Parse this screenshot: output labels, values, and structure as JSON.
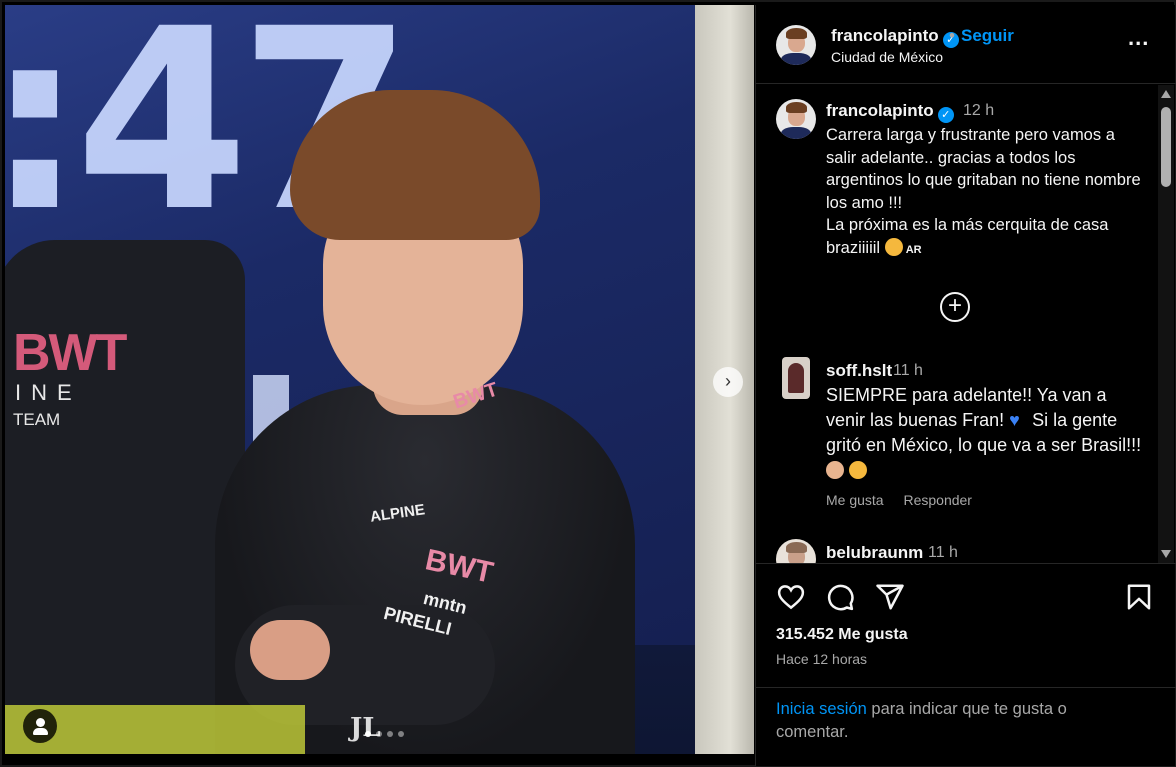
{
  "post": {
    "username": "francolapinto",
    "location": "Ciudad de México",
    "follow_label": "Seguir",
    "bullet": "•",
    "more_label": "...",
    "verified_mark": "✓"
  },
  "caption": {
    "username": "francolapinto",
    "time": "12 h",
    "text": "Carrera larga y frustrante pero vamos a salir adelante.. gracias a todos los argentinos lo que gritaban no tiene nombre los amo !!!\nLa próxima es la más cerquita de casa braziiiiil",
    "flag": "AR",
    "load_more": "+"
  },
  "comments": [
    {
      "username": "soff.hslt",
      "time": "11 h",
      "text_a": "SIEMPRE para adelante!! Ya van a venir las buenas Fran! ",
      "text_b": "  Si la gente gritó en México, lo que va a ser Brasil!!! ",
      "like_label": "Me gusta",
      "reply_label": "Responder"
    },
    {
      "username": "belubraunm",
      "time": "11 h"
    }
  ],
  "footer": {
    "likes": "315.452 Me gusta",
    "when": "Hace 12 horas",
    "login_link": "Inicia sesión",
    "login_rest": " para indicar que te gusta o comentar."
  },
  "photo": {
    "big_text": ":47",
    "left_brand": "BWT",
    "left_sub": "INE",
    "left_sub2": "TEAM",
    "logo_bwt": "BWT",
    "logo_alpine": "ALPINE",
    "logo_pirelli": "PIRELLI",
    "logo_mntn": "mntn",
    "logo_watermark": "JL",
    "next_arrow": "›"
  },
  "colors": {
    "accent": "#0095f6",
    "background": "#000000",
    "muted": "#a8a8a8"
  },
  "icons": [
    "heart-icon",
    "comment-icon",
    "share-icon",
    "bookmark-icon",
    "more-icon",
    "user-tag-icon",
    "chevron-right-icon",
    "plus-circle-icon"
  ]
}
